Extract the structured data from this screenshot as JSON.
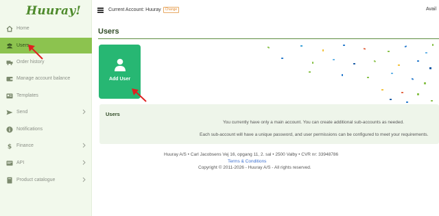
{
  "logo": "Huuray!",
  "sidebar": {
    "items": [
      {
        "label": "Home",
        "icon": "home-icon"
      },
      {
        "label": "Users",
        "icon": "users-icon",
        "active": true
      },
      {
        "label": "Order history",
        "icon": "truck-icon"
      },
      {
        "label": "Manage account balance",
        "icon": "wallet-icon"
      },
      {
        "label": "Templates",
        "icon": "template-icon"
      },
      {
        "label": "Send",
        "icon": "send-icon",
        "has_submenu": true
      },
      {
        "label": "Notifications",
        "icon": "info-icon"
      },
      {
        "label": "Finance",
        "icon": "dollar-icon",
        "has_submenu": true
      },
      {
        "label": "API",
        "icon": "code-icon",
        "has_submenu": true
      },
      {
        "label": "Product catalogue",
        "icon": "catalogue-icon",
        "has_submenu": true
      }
    ]
  },
  "topbar": {
    "account_label": "Current Account: Huuray",
    "change_label": "Change",
    "available_label": "Avail"
  },
  "page": {
    "title": "Users",
    "add_user_label": "Add User"
  },
  "panel": {
    "title": "Users",
    "line1": "You currently have only a main account. You can create additional sub-accounts as needed.",
    "line2": "Each sub-account will have a unique password, and user permissions can be configured to meet your requirements."
  },
  "footer": {
    "address": "Huuray A/S • Carl Jacobsens Vej 16, opgang 11, 2. sal • 2500 Valby • CVR nr: 33948786",
    "terms": "Terms & Conditions",
    "copyright": "Copyright © 2011-2026 - Huuray A/S - All rights reserved."
  },
  "colors": {
    "brand_green": "#8cc34f",
    "button_green": "#27b773",
    "arrow_red": "#e02020"
  }
}
